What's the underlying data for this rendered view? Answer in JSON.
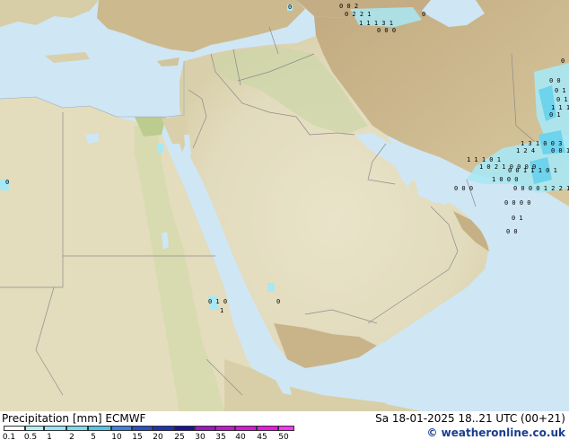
{
  "title": "Precipitation [mm] ECMWF",
  "valid_time": "Sa 18-01-2025 18..21 UTC (00+21)",
  "copyright": "© weatheronline.co.uk",
  "colors": {
    "sea": "#cfe6f4",
    "land_low": "#e6e0c4",
    "land_green": "#cbd7a8",
    "land_high": "#d2c29a",
    "mountain": "#b9a27a",
    "border": "#999999",
    "precip_light": "#a8e8f4",
    "precip_mid": "#6ed3ec"
  },
  "legend": {
    "ticks": [
      "0.1",
      "0.5",
      "1",
      "2",
      "5",
      "10",
      "15",
      "20",
      "25",
      "30",
      "35",
      "40",
      "45",
      "50"
    ],
    "colors": [
      "#fefefe",
      "#b4f0fa",
      "#96e6f5",
      "#78dcf0",
      "#50c8eb",
      "#3c82e1",
      "#2850c8",
      "#1e32b4",
      "#1414a0",
      "#a014c8",
      "#c814d2",
      "#dc14dc",
      "#f014e6",
      "#ff32ff"
    ]
  },
  "precip_labels": [
    "0",
    "0 0 2",
    "0 2 2 1",
    "1 1 1 3 1",
    "0 0 0",
    "0",
    "0 1",
    "0 0",
    "0 1 1",
    "0 1 0",
    "1 1 1",
    "0 1",
    "1 3 1 0 0 3",
    "0 0 1 1",
    "1 2 4",
    "1 0 2 1 0 0 0 0",
    "0 0 1 1 1 0 1",
    "0 0 0 0 1 2 2 1",
    "0 0 0",
    "1 1 1 0 1",
    "1 0 0 0",
    "0 0 0 0",
    "0 1",
    "0 0",
    "0",
    "0 1 0",
    "1",
    "0"
  ]
}
